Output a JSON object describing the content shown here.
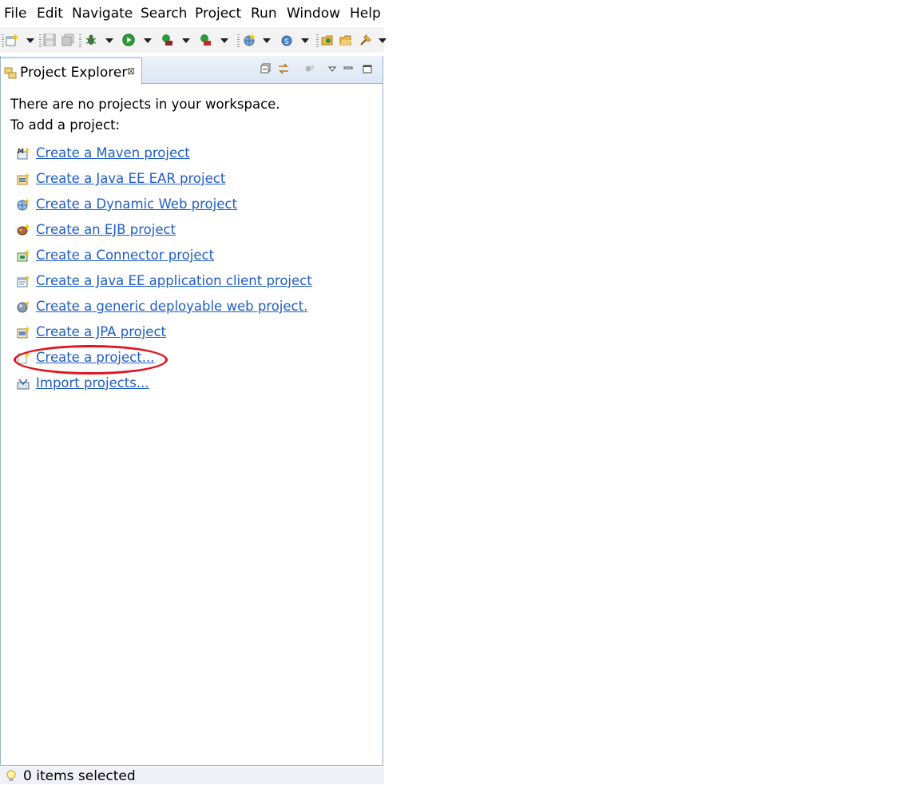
{
  "menu": [
    "File",
    "Edit",
    "Navigate",
    "Search",
    "Project",
    "Run",
    "Window",
    "Help"
  ],
  "toolbar": {
    "icons": [
      "new-wizard-icon",
      "save-icon",
      "save-all-icon",
      "debug-icon",
      "run-icon",
      "run-last-tool-icon",
      "coverage-icon",
      "new-server-icon",
      "new-web-service-icon",
      "open-type-icon",
      "open-task-icon",
      "search-icon"
    ]
  },
  "view": {
    "tab_label": "Project Explorer",
    "tab_close": "⊠",
    "toolbar_icons": [
      "collapse-all-icon",
      "link-with-editor-icon",
      "filter-icon",
      "view-menu-icon",
      "minimize-icon",
      "maximize-icon"
    ]
  },
  "content": {
    "empty_message": "There are no projects in your workspace.",
    "add_prompt": "To add a project:",
    "links": [
      {
        "label": "Create a Maven project",
        "icon": "maven-project-icon"
      },
      {
        "label": "Create a Java EE EAR project",
        "icon": "ear-project-icon"
      },
      {
        "label": "Create a Dynamic Web project",
        "icon": "web-project-icon"
      },
      {
        "label": "Create an EJB project",
        "icon": "ejb-project-icon"
      },
      {
        "label": "Create a Connector project",
        "icon": "connector-project-icon"
      },
      {
        "label": "Create a Java EE application client project",
        "icon": "app-client-project-icon"
      },
      {
        "label": "Create a generic deployable web project.",
        "icon": "generic-web-project-icon"
      },
      {
        "label": "Create a JPA project",
        "icon": "jpa-project-icon"
      },
      {
        "label": "Create a project...",
        "icon": "new-project-icon"
      },
      {
        "label": "Import projects...",
        "icon": "import-icon"
      }
    ]
  },
  "status": {
    "text": "0 items selected",
    "icon": "lightbulb-icon"
  },
  "colors": {
    "link": "#1f5dc6",
    "highlight": "#e0141e",
    "view_border": "#99b4d1"
  }
}
